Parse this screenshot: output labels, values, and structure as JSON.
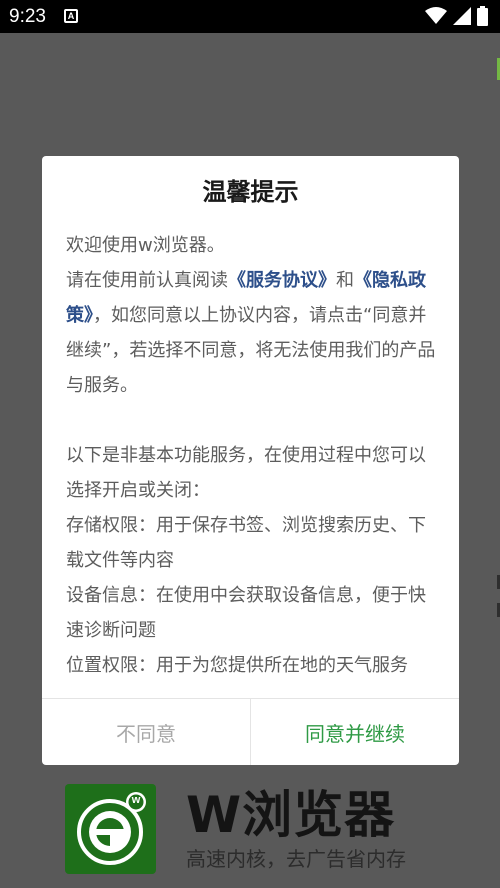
{
  "status_bar": {
    "time": "9:23",
    "notification_badge": "A"
  },
  "background": {
    "app_name": "W浏览器",
    "tagline": "高速内核，去广告省内存",
    "logo_badge": "w",
    "brand_color": "#1e6f1a"
  },
  "dialog": {
    "title": "温馨提示",
    "welcome": "欢迎使用w浏览器。",
    "intro_prefix": "请在使用前认真阅读",
    "service_link": "《服务协议》",
    "and": "和",
    "privacy_link": "《隐私政策》",
    "intro_suffix": "，如您同意以上协议内容，请点击“同意并继续”，若选择不同意，将无法使用我们的产品与服务。",
    "optional_intro": "以下是非基本功能服务，在使用过程中您可以选择开启或关闭：",
    "storage_permission": "存储权限：用于保存书签、浏览搜索历史、下载文件等内容",
    "device_info": "设备信息：在使用中会获取设备信息，便于快速诊断问题",
    "location_permission": "位置权限：用于为您提供所在地的天气服务",
    "disagree_button": "不同意",
    "agree_button": "同意并继续",
    "accent_color": "#2f9a45",
    "link_color": "#2d4f8a"
  }
}
